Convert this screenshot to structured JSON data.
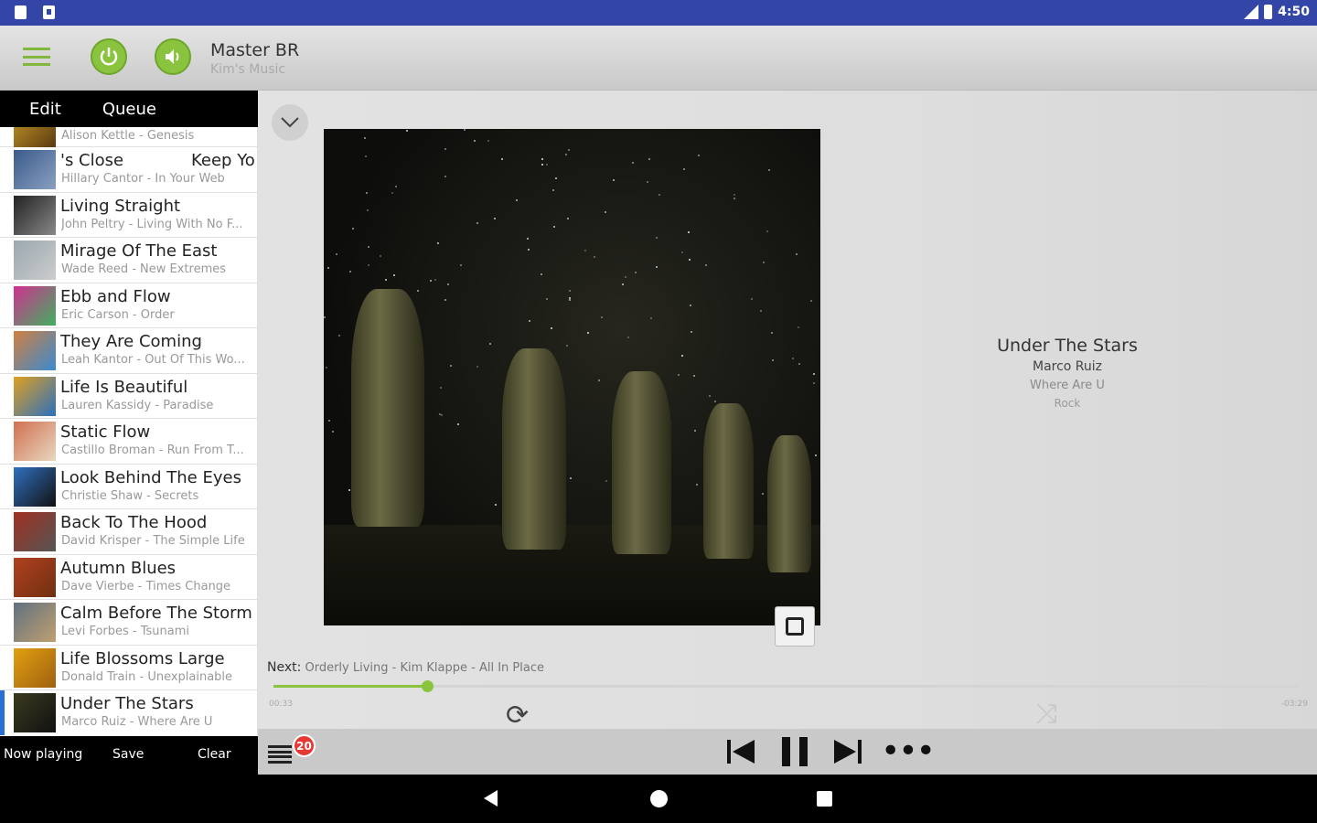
{
  "status_bar": {
    "time": "4:50"
  },
  "toolbar": {
    "zone_title": "Master BR",
    "zone_subtitle": "Kim's Music"
  },
  "left_tabs": {
    "edit": "Edit",
    "queue": "Queue"
  },
  "queue": [
    {
      "title": "",
      "subtitle": "Alison Kettle - Genesis",
      "colors": [
        "#c89a2a",
        "#5a3a10"
      ]
    },
    {
      "title": "'s Close",
      "title2": "Keep Yo",
      "subtitle": "Hillary Cantor - In Your Web",
      "colors": [
        "#3a5a8a",
        "#8aa0c0"
      ]
    },
    {
      "title": "Living Straight",
      "subtitle": "John Peltry - Living With No F...",
      "colors": [
        "#222",
        "#888"
      ]
    },
    {
      "title": "Mirage Of The East",
      "subtitle": "Wade Reed - New Extremes",
      "colors": [
        "#9aa8b0",
        "#ccc"
      ]
    },
    {
      "title": "Ebb and Flow",
      "subtitle": "Eric Carson - Order",
      "colors": [
        "#d03090",
        "#40b060"
      ]
    },
    {
      "title": "They Are Coming",
      "subtitle": "Leah Kantor - Out Of This Wo...",
      "colors": [
        "#d08040",
        "#3a8ad0"
      ]
    },
    {
      "title": "Life Is Beautiful",
      "subtitle": "Lauren Kassidy - Paradise",
      "colors": [
        "#e0a020",
        "#2a70c0"
      ]
    },
    {
      "title": "Static Flow",
      "subtitle": "Castillo Broman - Run From T...",
      "colors": [
        "#d07050",
        "#e8d8c0"
      ]
    },
    {
      "title": "Look Behind The Eyes",
      "subtitle": "Christie Shaw - Secrets",
      "colors": [
        "#3070c0",
        "#111"
      ]
    },
    {
      "title": "Back To The Hood",
      "subtitle": "David Krisper - The Simple Life",
      "colors": [
        "#a03020",
        "#555"
      ]
    },
    {
      "title": "Autumn Blues",
      "subtitle": "Dave Vierbe - Times Change",
      "colors": [
        "#b04020",
        "#703010"
      ]
    },
    {
      "title": "Calm Before The Storm",
      "subtitle": "Levi Forbes - Tsunami",
      "colors": [
        "#607080",
        "#c0a070"
      ]
    },
    {
      "title": "Life Blossoms Large",
      "subtitle": "Donald Train - Unexplainable",
      "colors": [
        "#e0a010",
        "#a06010"
      ]
    },
    {
      "title": "Under The Stars",
      "subtitle": "Marco Ruiz - Where Are U",
      "colors": [
        "#3a3a20",
        "#111"
      ]
    }
  ],
  "left_footer": {
    "now_playing": "Now playing",
    "save": "Save",
    "clear": "Clear"
  },
  "now_playing": {
    "title": "Under The Stars",
    "artist": "Marco Ruiz",
    "album": "Where Are U",
    "genre": "Rock",
    "next_label": "Next:",
    "next_track": "Orderly Living - Kim Klappe - All In Place",
    "elapsed": "00:33",
    "remaining": "-03:29",
    "progress": 0.15
  },
  "transport": {
    "queue_count": "20"
  }
}
